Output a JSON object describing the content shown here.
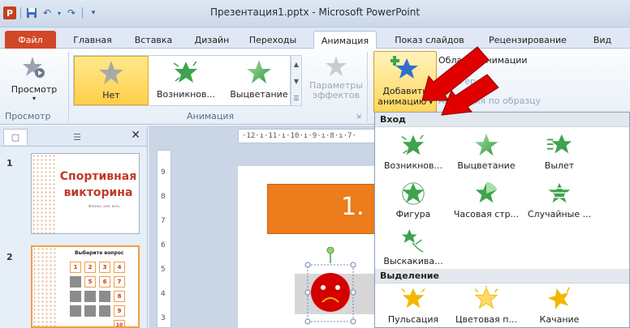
{
  "titlebar": {
    "app_icon": "P",
    "title": "Презентация1.pptx - Microsoft PowerPoint",
    "icons": [
      "powerpoint-icon",
      "save-icon",
      "undo-icon",
      "redo-icon",
      "customize-icon"
    ]
  },
  "tabs": [
    {
      "label": "Файл"
    },
    {
      "label": "Главная"
    },
    {
      "label": "Вставка"
    },
    {
      "label": "Дизайн"
    },
    {
      "label": "Переходы"
    },
    {
      "label": "Анимация"
    },
    {
      "label": "Показ слайдов"
    },
    {
      "label": "Рецензирование"
    },
    {
      "label": "Вид"
    }
  ],
  "ribbon": {
    "preview": {
      "label": "Просмотр",
      "group": "Просмотр"
    },
    "gallery": {
      "items": [
        {
          "label": "Нет",
          "selected": true
        },
        {
          "label": "Возникнов..."
        },
        {
          "label": "Выцветание"
        }
      ],
      "group": "Анимация"
    },
    "effect_options": {
      "label_line1": "Параметры",
      "label_line2": "эффектов"
    },
    "add_animation": {
      "line1": "Добавить",
      "line2": "анимацию"
    },
    "animation_pane": "Область анимации",
    "trigger": "Триггер",
    "animation_painter": "Анимация по образцу"
  },
  "left_panel": {
    "slides": [
      {
        "number": "1",
        "title_line1": "Спортивная",
        "title_line2": "викторина",
        "subtitle": "Физика, хим, вель"
      },
      {
        "number": "2",
        "title": "Выберите вопрос",
        "cells": [
          "1",
          "2",
          "3",
          "4",
          "5",
          "6",
          "7",
          "8",
          "9",
          "10"
        ]
      }
    ]
  },
  "editor": {
    "ruler_h": "·12·ı·11·ı·10·ı·9·ı·8·ı·7·",
    "ruler_v": [
      "9",
      "8",
      "7",
      "6",
      "5",
      "4",
      "3"
    ],
    "slide_title": "1. I"
  },
  "dropdown": {
    "sections": [
      {
        "title": "Вход",
        "items": [
          "Возникнов...",
          "Выцветание",
          "Вылет",
          "Фигура",
          "Часовая стр...",
          "Случайные ...",
          "Выскакива..."
        ]
      },
      {
        "title": "Выделение",
        "items": [
          "Пульсация",
          "Цветовая п...",
          "Качание"
        ]
      }
    ]
  },
  "colors": {
    "accent": "#d24726",
    "selected_gallery": "#ffcf4a",
    "entrance_star": "#3fa34d",
    "emphasis_star": "#f2b700",
    "arrow": "#e00000"
  }
}
